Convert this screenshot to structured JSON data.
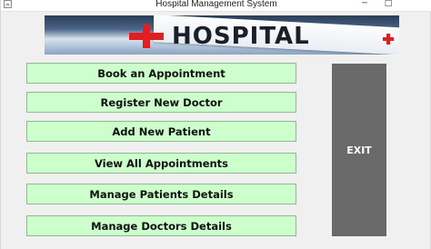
{
  "window": {
    "title": "Hospital Management System",
    "icon": "java-app-icon",
    "minimize_glyph": "─",
    "maximize_glyph": "□"
  },
  "banner": {
    "text": "HOSPITAL",
    "cross_color": "#e02020",
    "icon": "hospital-cross-icon"
  },
  "menu": {
    "buttons": [
      {
        "label": "Book an Appointment"
      },
      {
        "label": "Register New Doctor"
      },
      {
        "label": "Add New Patient"
      },
      {
        "label": "View All Appointments"
      },
      {
        "label": "Manage Patients Details"
      },
      {
        "label": "Manage Doctors Details"
      }
    ],
    "button_color": "#ccffcc"
  },
  "exit": {
    "label": "EXIT",
    "color": "#696969"
  }
}
